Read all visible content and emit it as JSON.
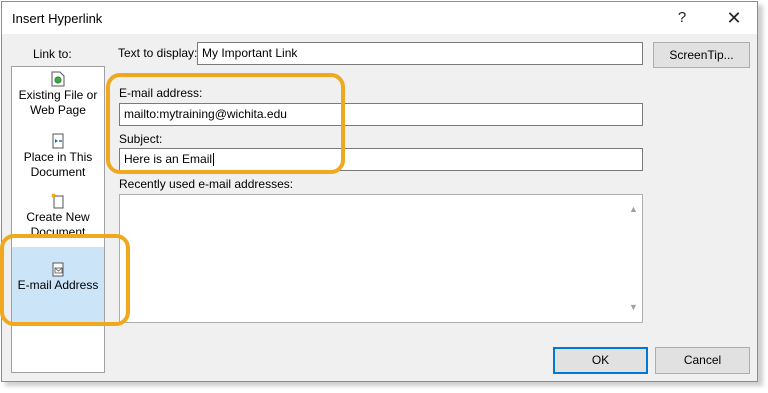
{
  "window": {
    "title": "Insert Hyperlink",
    "help_label": "?",
    "close_label": "✕"
  },
  "link_to": {
    "label": "Link to:",
    "items": [
      {
        "label_line1": "Existing File or",
        "label_line2": "Web Page",
        "icon": "web-page-icon"
      },
      {
        "label_line1": "Place in This",
        "label_line2": "Document",
        "icon": "document-place-icon"
      },
      {
        "label_line1": "Create New",
        "label_line2": "Document",
        "icon": "new-document-icon"
      },
      {
        "label": "E-mail Address",
        "icon": "email-icon",
        "selected": true
      }
    ]
  },
  "text_to_display": {
    "label": "Text to display:",
    "value": "My Important Link"
  },
  "screentip_button": "ScreenTip...",
  "email_address": {
    "label": "E-mail address:",
    "value": "mailto:mytraining@wichita.edu"
  },
  "subject": {
    "label": "Subject:",
    "value": "Here is an Email"
  },
  "recent": {
    "label": "Recently used e-mail addresses:",
    "items": []
  },
  "buttons": {
    "ok": "OK",
    "cancel": "Cancel"
  },
  "colors": {
    "highlight": "#f0a91e",
    "selected_bg": "#cce4f7",
    "default_button_border": "#0078d7"
  }
}
